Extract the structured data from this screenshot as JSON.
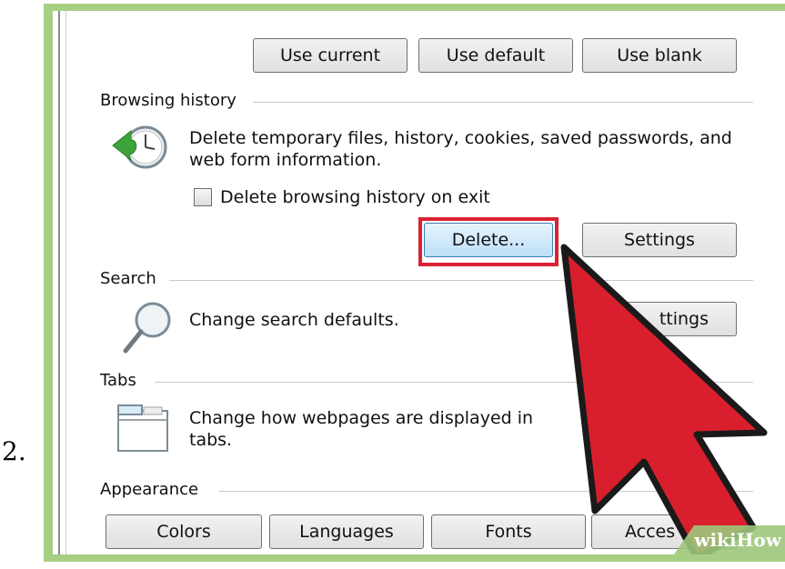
{
  "step_number": "2.",
  "home_buttons": [
    "Use current",
    "Use default",
    "Use blank"
  ],
  "browsing_history": {
    "heading": "Browsing history",
    "description_line1": "Delete temporary files, history, cookies, saved passwords, and",
    "description_line2": "web form information.",
    "checkbox_label": "Delete browsing history on exit",
    "delete_label": "Delete...",
    "settings_label": "Settings"
  },
  "search": {
    "heading": "Search",
    "description": "Change search defaults.",
    "settings_label": "ttings"
  },
  "tabs": {
    "heading": "Tabs",
    "description_line1": "Change how webpages are displayed in",
    "description_line2": "tabs."
  },
  "appearance": {
    "heading": "Appearance",
    "buttons": [
      "Colors",
      "Languages",
      "Fonts",
      "Acces"
    ]
  },
  "watermark": "wikiHow",
  "colors": {
    "highlight": "#d92233",
    "arrow": "#d91f2d",
    "frame_green": "#a7cf84"
  }
}
